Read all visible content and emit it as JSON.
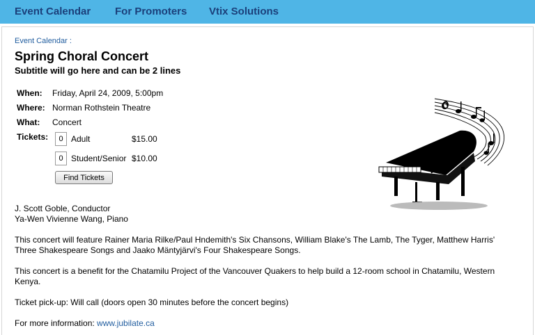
{
  "nav": {
    "items": [
      "Event Calendar",
      "For Promoters",
      "Vtix Solutions"
    ]
  },
  "breadcrumb": {
    "link": "Event Calendar",
    "separator": ":"
  },
  "event": {
    "title": "Spring Choral Concert",
    "subtitle": "Subtitle will go here and can be 2 lines",
    "when_label": "When:",
    "when": "Friday, April 24, 2009, 5:00pm",
    "where_label": "Where:",
    "where": "Norman Rothstein Theatre",
    "what_label": "What:",
    "what": "Concert",
    "tickets_label": "Tickets:"
  },
  "tickets": [
    {
      "qty": "0",
      "name": "Adult",
      "price": "$15.00"
    },
    {
      "qty": "0",
      "name": "Student/Senior",
      "price": "$10.00"
    }
  ],
  "find_tickets_label": "Find Tickets",
  "description": {
    "performers": [
      "J. Scott Goble, Conductor",
      "Ya-Wen Vivienne Wang, Piano"
    ],
    "program": [
      "This concert will feature Rainer Maria Rilke/Paul Hndemith's Six Chansons, William Blake's The Lamb, The Tyger, Matthew Harris'",
      "Three Shakespeare Songs and Jaako Mäntyjärvi's Four Shakespeare Songs."
    ],
    "benefit": [
      "This concert is a benefit for the Chatamilu Project of the Vancouver Quakers to help build a 12-room school in Chatamilu, Western",
      "Kenya."
    ],
    "pickup": "Ticket pick-up: Will call (doors open 30 minutes before the concert begins)",
    "more_info_label": "For more information:",
    "more_info_link": "www.jubilate.ca"
  },
  "image": {
    "icon": "grand-piano-with-music-notes"
  },
  "colors": {
    "nav_bg": "#4fb5e6",
    "nav_text": "#1b3f7a",
    "link": "#1f5c9e"
  }
}
